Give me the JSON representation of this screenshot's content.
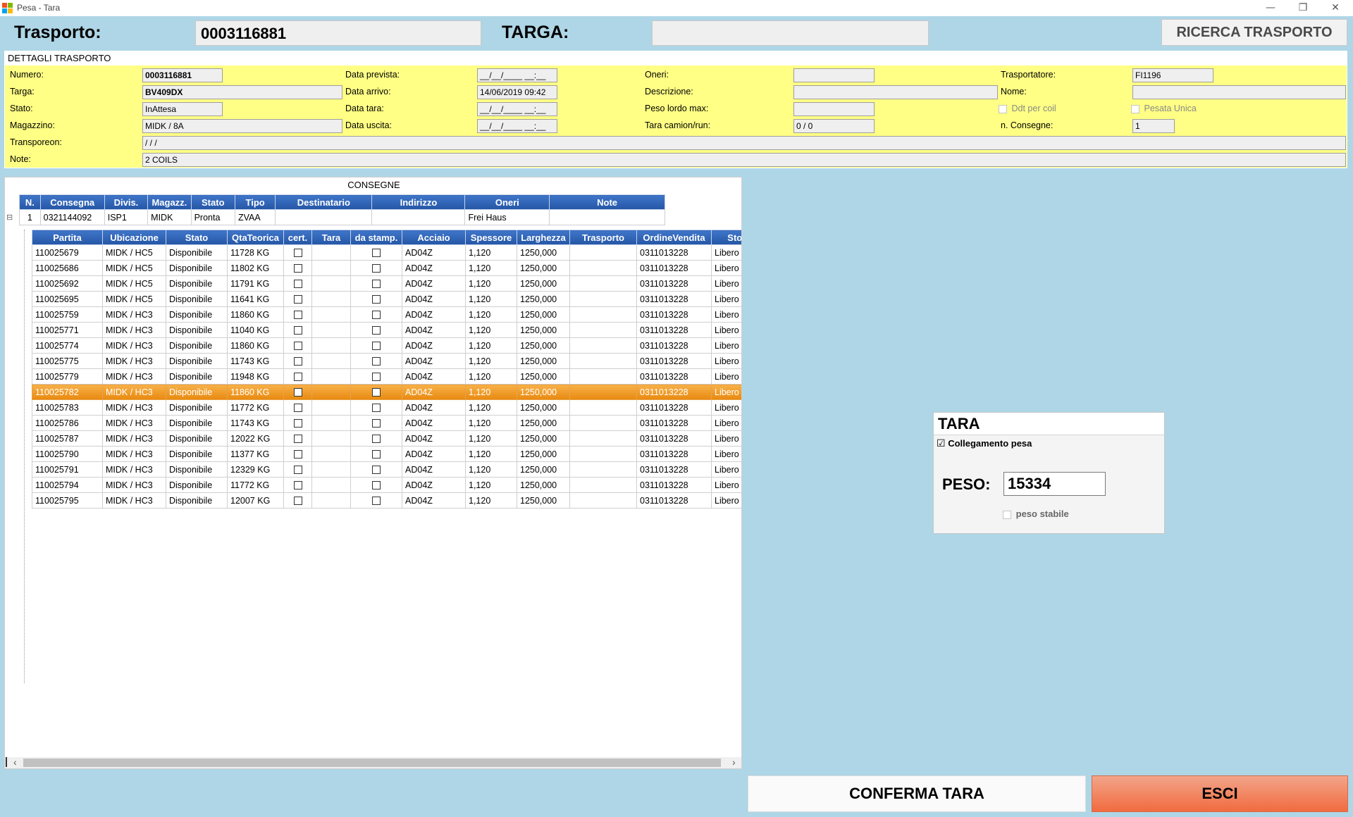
{
  "window": {
    "title": "Pesa - Tara",
    "minimize": "—",
    "restore": "❐",
    "close": "✕"
  },
  "header": {
    "trasporto_label": "Trasporto:",
    "trasporto_value": "0003116881",
    "targa_label": "TARGA:",
    "targa_value": "",
    "ricerca_label": "RICERCA TRASPORTO"
  },
  "dettagli": {
    "title": "DETTAGLI TRASPORTO",
    "numero_label": "Numero:",
    "numero": "0003116881",
    "targa_label": "Targa:",
    "targa": "BV409DX",
    "stato_label": "Stato:",
    "stato": "InAttesa",
    "magazzino_label": "Magazzino:",
    "magazzino": "MIDK / 8A",
    "transporeon_label": "Transporeon:",
    "transporeon": " /  /  /",
    "note_label": "Note:",
    "note": "2 COILS",
    "data_prevista_label": "Data prevista:",
    "data_prevista": "__/__/____ __:__",
    "data_arrivo_label": "Data arrivo:",
    "data_arrivo": "14/06/2019 09:42",
    "data_tara_label": "Data tara:",
    "data_tara": "__/__/____ __:__",
    "data_uscita_label": "Data uscita:",
    "data_uscita": "__/__/____ __:__",
    "oneri_label": "Oneri:",
    "oneri": "",
    "descrizione_label": "Descrizione:",
    "descrizione": "",
    "peso_lordo_label": "Peso lordo max:",
    "peso_lordo": "",
    "tara_camion_label": "Tara camion/run:",
    "tara_camion": "0 / 0",
    "trasportatore_label": "Trasportatore:",
    "trasportatore": "FI1196",
    "nome_label": "Nome:",
    "nome": "",
    "ddt_label": "Ddt per coil",
    "pesata_unica_label": "Pesata Unica",
    "n_consegne_label": "n. Consegne:",
    "n_consegne": "1"
  },
  "consegne": {
    "title": "CONSEGNE",
    "columns": [
      "N.",
      "Consegna",
      "Divis.",
      "Magazz.",
      "Stato",
      "Tipo",
      "Destinatario",
      "Indirizzo",
      "Oneri",
      "Note"
    ],
    "row": {
      "n": "1",
      "consegna": "0321144092",
      "divis": "ISP1",
      "magazz": "MIDK",
      "stato": "Pronta",
      "tipo": "ZVAA",
      "destinatario": "",
      "indirizzo": "",
      "oneri": "Frei Haus",
      "note": ""
    },
    "expand_glyph": "⊟"
  },
  "partite": {
    "columns": [
      "Partita",
      "Ubicazione",
      "Stato",
      "QtaTeorica",
      "cert.",
      "Tara",
      "da stamp.",
      "Acciaio",
      "Spessore",
      "Larghezza",
      "Trasporto",
      "OrdineVendita",
      "Stock"
    ],
    "rows": [
      {
        "partita": "110025679",
        "ubicazione": "MIDK / HC5",
        "stato": "Disponibile",
        "qta": "11728 KG",
        "tara": "",
        "acciaio": "AD04Z",
        "spessore": "1,120",
        "larghezza": "1250,000",
        "trasporto": "",
        "ordine": "0311013228",
        "stock": "Libero",
        "selected": false
      },
      {
        "partita": "110025686",
        "ubicazione": "MIDK / HC5",
        "stato": "Disponibile",
        "qta": "11802 KG",
        "tara": "",
        "acciaio": "AD04Z",
        "spessore": "1,120",
        "larghezza": "1250,000",
        "trasporto": "",
        "ordine": "0311013228",
        "stock": "Libero",
        "selected": false
      },
      {
        "partita": "110025692",
        "ubicazione": "MIDK / HC5",
        "stato": "Disponibile",
        "qta": "11791 KG",
        "tara": "",
        "acciaio": "AD04Z",
        "spessore": "1,120",
        "larghezza": "1250,000",
        "trasporto": "",
        "ordine": "0311013228",
        "stock": "Libero",
        "selected": false
      },
      {
        "partita": "110025695",
        "ubicazione": "MIDK / HC5",
        "stato": "Disponibile",
        "qta": "11641 KG",
        "tara": "",
        "acciaio": "AD04Z",
        "spessore": "1,120",
        "larghezza": "1250,000",
        "trasporto": "",
        "ordine": "0311013228",
        "stock": "Libero",
        "selected": false
      },
      {
        "partita": "110025759",
        "ubicazione": "MIDK / HC3",
        "stato": "Disponibile",
        "qta": "11860 KG",
        "tara": "",
        "acciaio": "AD04Z",
        "spessore": "1,120",
        "larghezza": "1250,000",
        "trasporto": "",
        "ordine": "0311013228",
        "stock": "Libero",
        "selected": false
      },
      {
        "partita": "110025771",
        "ubicazione": "MIDK / HC3",
        "stato": "Disponibile",
        "qta": "11040 KG",
        "tara": "",
        "acciaio": "AD04Z",
        "spessore": "1,120",
        "larghezza": "1250,000",
        "trasporto": "",
        "ordine": "0311013228",
        "stock": "Libero",
        "selected": false
      },
      {
        "partita": "110025774",
        "ubicazione": "MIDK / HC3",
        "stato": "Disponibile",
        "qta": "11860 KG",
        "tara": "",
        "acciaio": "AD04Z",
        "spessore": "1,120",
        "larghezza": "1250,000",
        "trasporto": "",
        "ordine": "0311013228",
        "stock": "Libero",
        "selected": false
      },
      {
        "partita": "110025775",
        "ubicazione": "MIDK / HC3",
        "stato": "Disponibile",
        "qta": "11743 KG",
        "tara": "",
        "acciaio": "AD04Z",
        "spessore": "1,120",
        "larghezza": "1250,000",
        "trasporto": "",
        "ordine": "0311013228",
        "stock": "Libero",
        "selected": false
      },
      {
        "partita": "110025779",
        "ubicazione": "MIDK / HC3",
        "stato": "Disponibile",
        "qta": "11948 KG",
        "tara": "",
        "acciaio": "AD04Z",
        "spessore": "1,120",
        "larghezza": "1250,000",
        "trasporto": "",
        "ordine": "0311013228",
        "stock": "Libero",
        "selected": false
      },
      {
        "partita": "110025782",
        "ubicazione": "MIDK / HC3",
        "stato": "Disponibile",
        "qta": "11860 KG",
        "tara": "",
        "acciaio": "AD04Z",
        "spessore": "1,120",
        "larghezza": "1250,000",
        "trasporto": "",
        "ordine": "0311013228",
        "stock": "Libero",
        "selected": true
      },
      {
        "partita": "110025783",
        "ubicazione": "MIDK / HC3",
        "stato": "Disponibile",
        "qta": "11772 KG",
        "tara": "",
        "acciaio": "AD04Z",
        "spessore": "1,120",
        "larghezza": "1250,000",
        "trasporto": "",
        "ordine": "0311013228",
        "stock": "Libero",
        "selected": false
      },
      {
        "partita": "110025786",
        "ubicazione": "MIDK / HC3",
        "stato": "Disponibile",
        "qta": "11743 KG",
        "tara": "",
        "acciaio": "AD04Z",
        "spessore": "1,120",
        "larghezza": "1250,000",
        "trasporto": "",
        "ordine": "0311013228",
        "stock": "Libero",
        "selected": false
      },
      {
        "partita": "110025787",
        "ubicazione": "MIDK / HC3",
        "stato": "Disponibile",
        "qta": "12022 KG",
        "tara": "",
        "acciaio": "AD04Z",
        "spessore": "1,120",
        "larghezza": "1250,000",
        "trasporto": "",
        "ordine": "0311013228",
        "stock": "Libero",
        "selected": false
      },
      {
        "partita": "110025790",
        "ubicazione": "MIDK / HC3",
        "stato": "Disponibile",
        "qta": "11377 KG",
        "tara": "",
        "acciaio": "AD04Z",
        "spessore": "1,120",
        "larghezza": "1250,000",
        "trasporto": "",
        "ordine": "0311013228",
        "stock": "Libero",
        "selected": false
      },
      {
        "partita": "110025791",
        "ubicazione": "MIDK / HC3",
        "stato": "Disponibile",
        "qta": "12329 KG",
        "tara": "",
        "acciaio": "AD04Z",
        "spessore": "1,120",
        "larghezza": "1250,000",
        "trasporto": "",
        "ordine": "0311013228",
        "stock": "Libero",
        "selected": false
      },
      {
        "partita": "110025794",
        "ubicazione": "MIDK / HC3",
        "stato": "Disponibile",
        "qta": "11772 KG",
        "tara": "",
        "acciaio": "AD04Z",
        "spessore": "1,120",
        "larghezza": "1250,000",
        "trasporto": "",
        "ordine": "0311013228",
        "stock": "Libero",
        "selected": false
      },
      {
        "partita": "110025795",
        "ubicazione": "MIDK / HC3",
        "stato": "Disponibile",
        "qta": "12007 KG",
        "tara": "",
        "acciaio": "AD04Z",
        "spessore": "1,120",
        "larghezza": "1250,000",
        "trasporto": "",
        "ordine": "0311013228",
        "stock": "Libero",
        "selected": false
      }
    ]
  },
  "scroll": {
    "left": "‹",
    "right": "›"
  },
  "tara_panel": {
    "title": "TARA",
    "collegamento_label": "Collegamento pesa",
    "collegamento_checked": "☑",
    "peso_label": "PESO:",
    "peso_value": "15334",
    "peso_stabile_label": "peso stabile"
  },
  "buttons": {
    "conferma": "CONFERMA TARA",
    "esci": "ESCI"
  },
  "colors": {
    "background": "#aed6e6",
    "panel": "#ffff85",
    "header_blue": "#2f64b7",
    "selected_row": "#f0a030",
    "esci": "#f16b3f"
  }
}
